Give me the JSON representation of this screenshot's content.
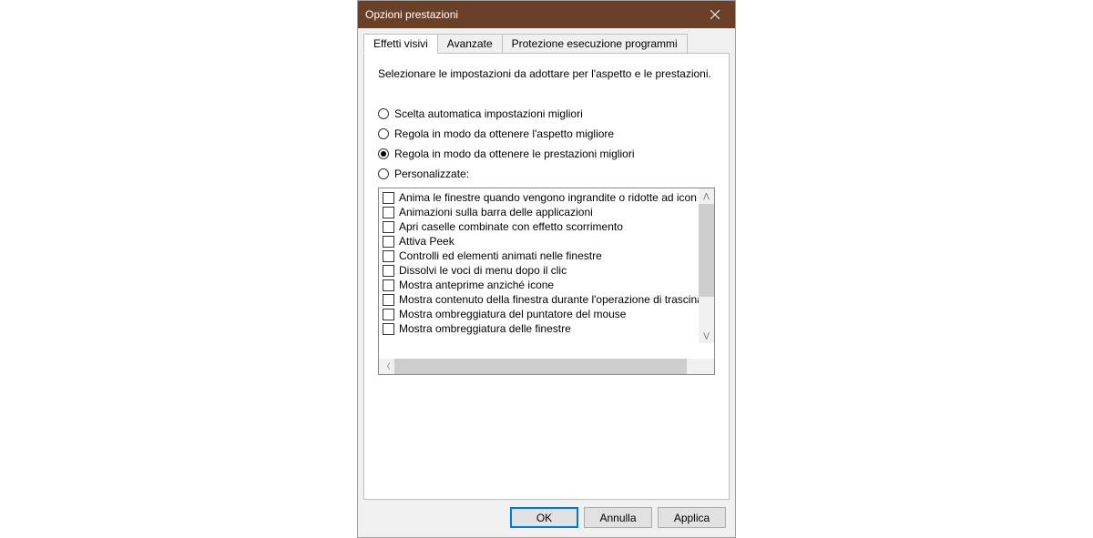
{
  "titlebar": {
    "title": "Opzioni prestazioni"
  },
  "tabs": [
    {
      "label": "Effetti visivi",
      "active": true
    },
    {
      "label": "Avanzate",
      "active": false
    },
    {
      "label": "Protezione esecuzione programmi",
      "active": false
    }
  ],
  "description": "Selezionare le impostazioni da adottare per l'aspetto e le prestazioni.",
  "radios": [
    {
      "label": "Scelta automatica impostazioni migliori",
      "selected": false
    },
    {
      "label": "Regola in modo da ottenere l'aspetto migliore",
      "selected": false
    },
    {
      "label": "Regola in modo da ottenere le prestazioni migliori",
      "selected": true
    },
    {
      "label": "Personalizzate:",
      "selected": false
    }
  ],
  "checkitems": [
    {
      "label": "Anima le finestre quando vengono ingrandite o ridotte ad icon"
    },
    {
      "label": "Animazioni sulla barra delle applicazioni"
    },
    {
      "label": "Apri caselle combinate con effetto scorrimento"
    },
    {
      "label": "Attiva Peek"
    },
    {
      "label": "Controlli ed elementi animati nelle finestre"
    },
    {
      "label": "Dissolvi le voci di menu dopo il clic"
    },
    {
      "label": "Mostra anteprime anziché icone"
    },
    {
      "label": "Mostra contenuto della finestra durante l'operazione di trascina"
    },
    {
      "label": "Mostra ombreggiatura del puntatore del mouse"
    },
    {
      "label": "Mostra ombreggiatura delle finestre"
    }
  ],
  "buttons": {
    "ok": "OK",
    "cancel": "Annulla",
    "apply": "Applica"
  }
}
